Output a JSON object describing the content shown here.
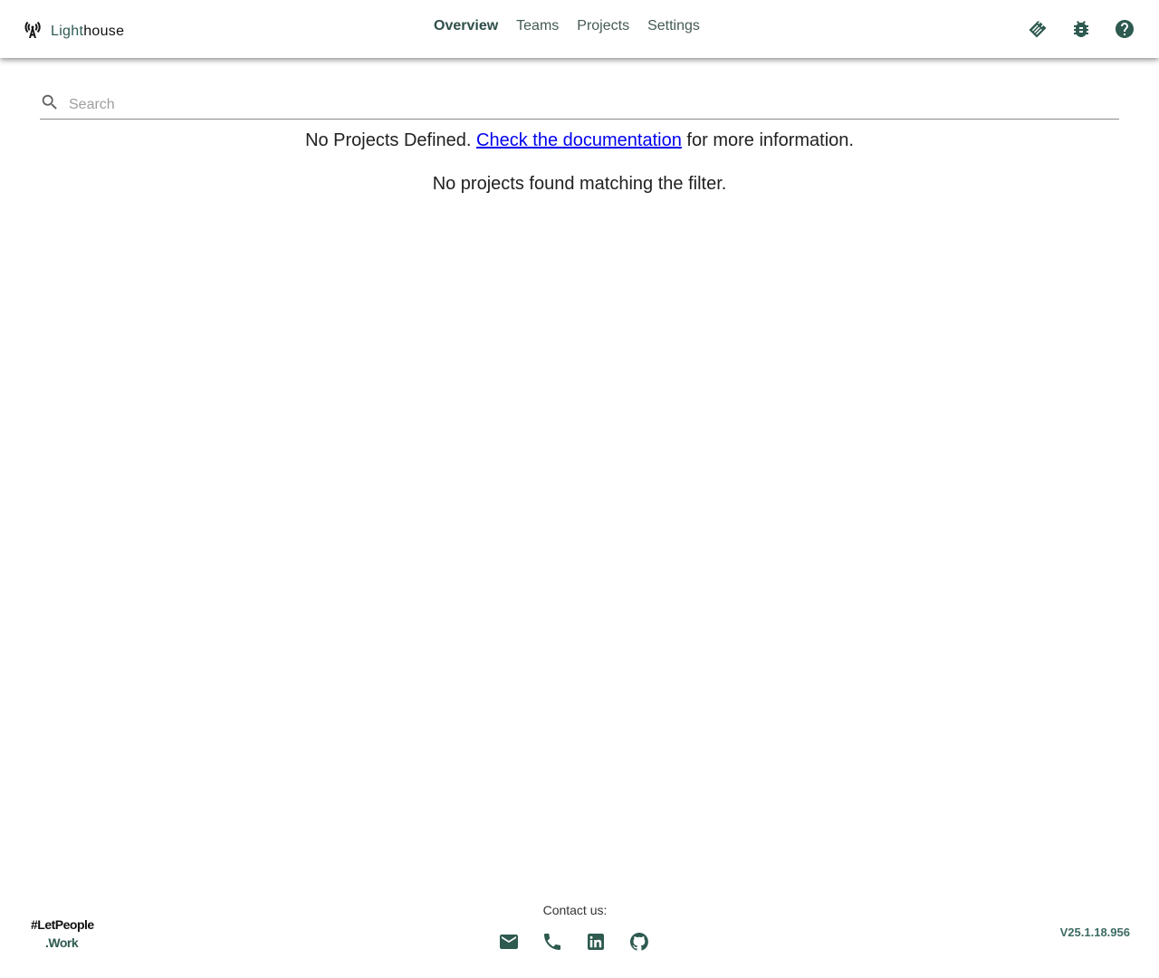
{
  "header": {
    "brand_light": "Light",
    "brand_house": "house",
    "nav": [
      {
        "label": "Overview",
        "active": true
      },
      {
        "label": "Teams",
        "active": false
      },
      {
        "label": "Projects",
        "active": false
      },
      {
        "label": "Settings",
        "active": false
      }
    ],
    "actions": [
      "handshake-icon",
      "bug-icon",
      "help-icon"
    ]
  },
  "search": {
    "placeholder": "Search",
    "value": ""
  },
  "main": {
    "no_projects_prefix": "No Projects Defined.",
    "doc_link": "Check the documentation",
    "no_projects_suffix": "for more information.",
    "no_match": "No projects found matching the filter."
  },
  "footer": {
    "logo_line1": "#LetPeople",
    "logo_line2": ".Work",
    "contact_label": "Contact us:",
    "contact_icons": [
      "email-icon",
      "phone-icon",
      "linkedin-icon",
      "github-icon"
    ],
    "version": "V25.1.18.956"
  },
  "colors": {
    "accent": "#2e5a50",
    "link": "#0000ee"
  }
}
